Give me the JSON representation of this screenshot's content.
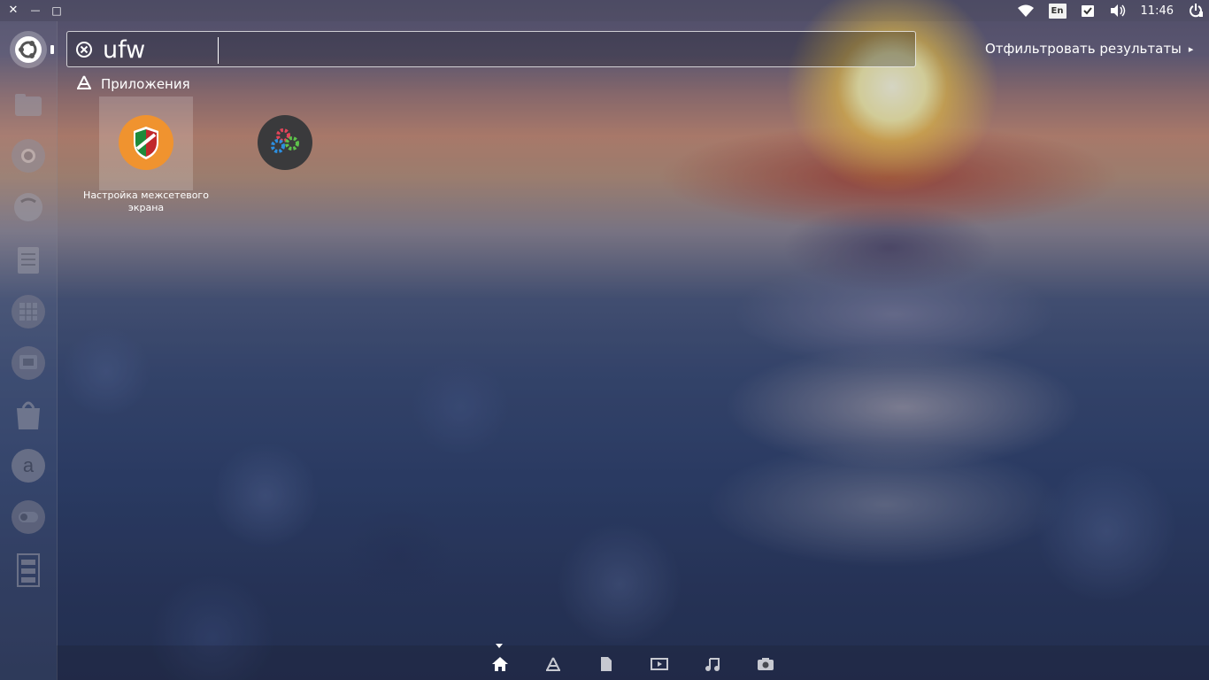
{
  "top_panel": {
    "close_glyph": "✕",
    "minimize_glyph": "—",
    "maximize_glyph": "□",
    "tray": {
      "wifi_icon": "wifi-icon",
      "keyboard_layout": "En",
      "update_icon": "check-icon",
      "volume_icon": "volume-icon",
      "time": "11:46",
      "session_icon": "power-icon"
    }
  },
  "launcher": {
    "items": [
      {
        "name": "ubuntu-dash-icon",
        "active": true
      },
      {
        "name": "files-icon"
      },
      {
        "name": "chrome-icon"
      },
      {
        "name": "messenger-icon"
      },
      {
        "name": "text-editor-icon"
      },
      {
        "name": "spreadsheet-icon"
      },
      {
        "name": "presentation-icon"
      },
      {
        "name": "software-center-icon"
      },
      {
        "name": "amazon-icon"
      },
      {
        "name": "settings-toggle-icon"
      },
      {
        "name": "workspace-icon"
      }
    ]
  },
  "search": {
    "query": "ufw",
    "clear_icon": "close-circle-icon"
  },
  "filter": {
    "label": "Отфильтровать результаты",
    "arrow": "▸"
  },
  "category": {
    "icon": "applications-icon",
    "label": "Приложения"
  },
  "results": [
    {
      "label": "Настройка межсетевого экрана",
      "icon": "firewall-shield-icon",
      "selected": true
    },
    {
      "label": "",
      "icon": "gears-icon",
      "selected": false
    }
  ],
  "lenses": [
    {
      "name": "home-lens-icon",
      "active": true
    },
    {
      "name": "applications-lens-icon"
    },
    {
      "name": "files-lens-icon"
    },
    {
      "name": "video-lens-icon"
    },
    {
      "name": "music-lens-icon"
    },
    {
      "name": "photo-lens-icon"
    }
  ],
  "colors": {
    "firewall_icon_bg": "#f0932f",
    "gears_icon_bg": "#3a3a3c",
    "text": "#ffffff"
  }
}
